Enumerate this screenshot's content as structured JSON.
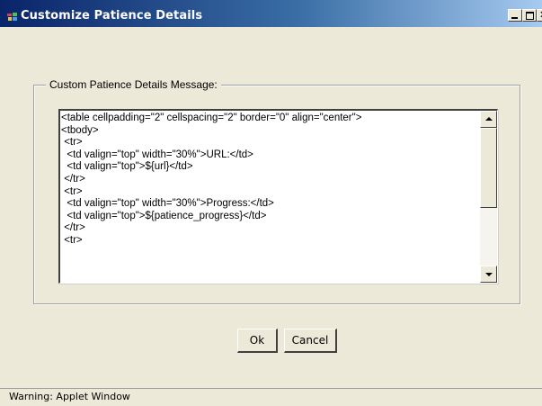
{
  "window": {
    "title": "Customize Patience Details",
    "controls": {
      "minimize": "_",
      "maximize": "□",
      "close": "✕"
    }
  },
  "group": {
    "label": "Custom Patience Details Message:"
  },
  "editor": {
    "lines": [
      "<table cellpadding=\"2\" cellspacing=\"2\" border=\"0\" align=\"center\">",
      "<tbody>",
      " <tr>",
      "  <td valign=\"top\" width=\"30%\">URL:</td>",
      "  <td valign=\"top\">${url}</td>",
      " </tr>",
      " <tr>",
      "  <td valign=\"top\" width=\"30%\">Progress:</td>",
      "  <td valign=\"top\">${patience_progress}</td>",
      " </tr>",
      " <tr>"
    ],
    "scroll_position": 0.0
  },
  "buttons": {
    "ok": "Ok",
    "cancel": "Cancel"
  },
  "status": {
    "text": "Warning: Applet Window"
  },
  "icons": {
    "app": "java-app-icon",
    "scroll_up": "scroll-up-arrow-icon",
    "scroll_down": "scroll-down-arrow-icon"
  },
  "colors": {
    "title_start": "#0a246a",
    "title_end": "#a6caf0",
    "surface": "#ece9d8"
  }
}
